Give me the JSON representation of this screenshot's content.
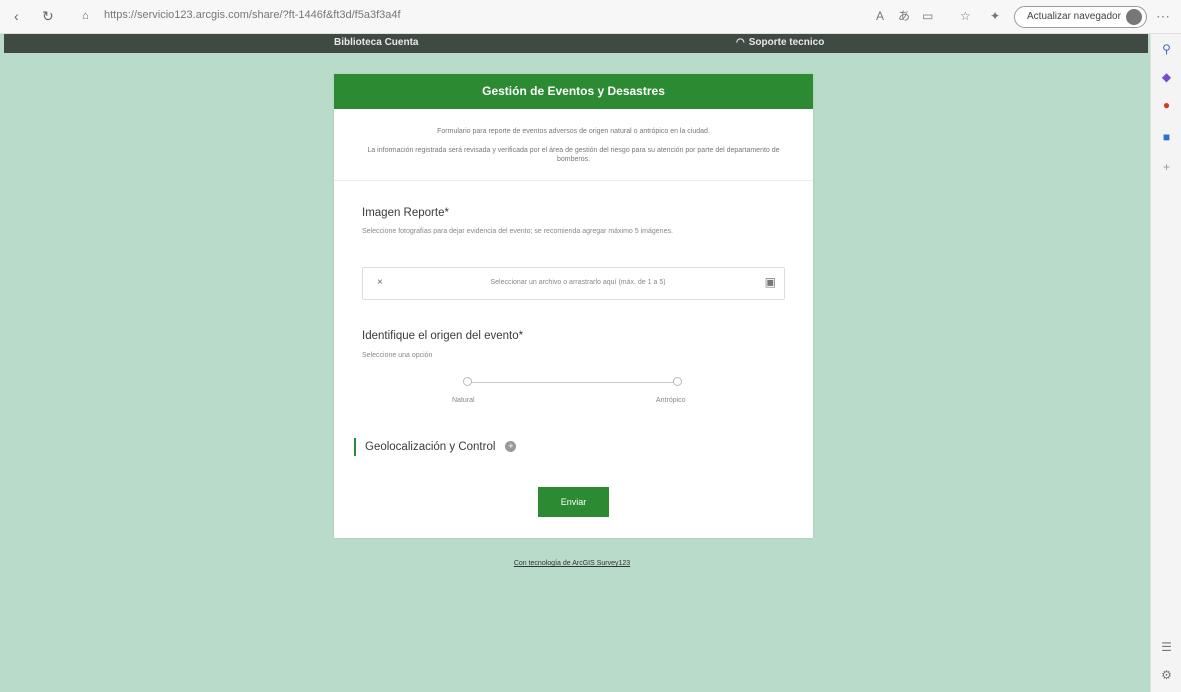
{
  "browser": {
    "url": "https://servicio123.arcgis.com/share/?ft-1446f&ft3d/f5a3f3a4f",
    "profile_label": "Actualizar navegador"
  },
  "site": {
    "nav_label": "Biblioteca  Cuenta",
    "support_label": "Soporte tecnico"
  },
  "form": {
    "title": "Gestión de Eventos y Desastres",
    "intro_1": "Formulario para reporte de eventos adversos de origen natural o antrópico en la ciudad.",
    "intro_2": "La información registrada será revisada y verificada por el área de gestión del riesgo para su atención por parte del departamento de bomberos.",
    "image_field": {
      "label": "Imagen Reporte*",
      "help": "Seleccione fotografías para dejar evidencia del evento; se recomienda agregar máximo 5 imágenes.",
      "placeholder": "Seleccionar un archivo o arrastrarlo aquí (máx. de 1 a 5)"
    },
    "origin_field": {
      "label": "Identifique el origen del evento*",
      "help": "Seleccione una opción",
      "options": [
        "Natural",
        "Antrópico"
      ]
    },
    "geo_section": {
      "label": "Geolocalización y Control"
    },
    "submit_label": "Enviar"
  },
  "footer": {
    "link_label": "Con tecnología de ArcGIS Survey123"
  }
}
